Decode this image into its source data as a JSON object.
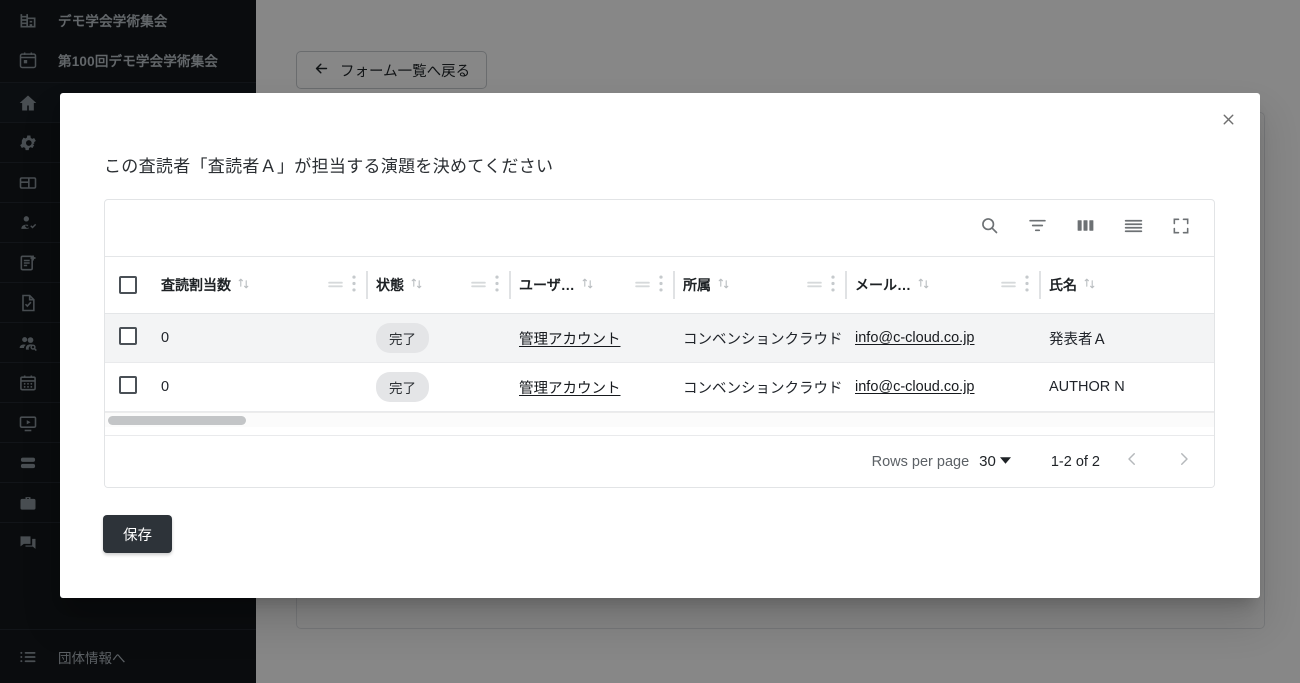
{
  "sidebar": {
    "org": [
      {
        "label": "デモ学会学術集会",
        "icon": "building-icon"
      },
      {
        "label": "第100回デモ学会学術集会",
        "icon": "calendar-icon"
      }
    ],
    "nav": [
      {
        "icon": "home-icon",
        "label": ""
      },
      {
        "icon": "gear-icon",
        "label": ""
      },
      {
        "icon": "layout-icon",
        "label": ""
      },
      {
        "icon": "person-check-icon",
        "label": ""
      },
      {
        "icon": "note-add-icon",
        "label": ""
      },
      {
        "icon": "document-check-icon",
        "label": ""
      },
      {
        "icon": "people-search-icon",
        "label": ""
      },
      {
        "icon": "calendar-month-icon",
        "label": ""
      },
      {
        "icon": "video-screen-icon",
        "label": ""
      },
      {
        "icon": "database-icon",
        "label": ""
      },
      {
        "icon": "briefcase-icon",
        "label": ""
      },
      {
        "icon": "chat-icon",
        "label": ""
      }
    ],
    "bottom": {
      "icon": "list-icon",
      "label": "団体情報へ"
    }
  },
  "page": {
    "back_button": "フォーム一覧へ戻る",
    "back_icon": "arrow-left-icon"
  },
  "modal": {
    "close_icon": "close-icon",
    "title": "この査読者「査読者Ａ」が担当する演題を決めてください",
    "save_label": "保存"
  },
  "grid": {
    "toolbar": [
      {
        "icon": "search-icon",
        "name": "search-button"
      },
      {
        "icon": "filter-icon",
        "name": "filter-button"
      },
      {
        "icon": "columns-icon",
        "name": "columns-button"
      },
      {
        "icon": "density-icon",
        "name": "density-button"
      },
      {
        "icon": "fullscreen-icon",
        "name": "fullscreen-button"
      }
    ],
    "columns": [
      {
        "label": "査読割当数",
        "sortable": true
      },
      {
        "label": "状態",
        "sortable": true
      },
      {
        "label": "ユーザ…",
        "sortable": true
      },
      {
        "label": "所属",
        "sortable": true
      },
      {
        "label": "メール…",
        "sortable": true
      },
      {
        "label": "氏名",
        "sortable": true
      }
    ],
    "rows": [
      {
        "selected": false,
        "assign_count": "0",
        "status": "完了",
        "user": "管理アカウント",
        "affiliation": "コンベンションクラウド",
        "email": "info@c-cloud.co.jp",
        "name": "発表者Ａ"
      },
      {
        "selected": false,
        "assign_count": "0",
        "status": "完了",
        "user": "管理アカウント",
        "affiliation": "コンベンションクラウド",
        "email": "info@c-cloud.co.jp",
        "name": "AUTHOR N"
      }
    ],
    "footer": {
      "rows_per_page_label": "Rows per page",
      "rows_per_page_value": "30",
      "range": "1-2 of 2",
      "prev_icon": "chevron-left-icon",
      "next_icon": "chevron-right-icon"
    }
  },
  "colors": {
    "sidebar_bg": "#13181c",
    "save_button_bg": "#2d3339",
    "chip_bg": "#e4e5e7",
    "overlay": "rgba(0,0,0,0.47)"
  }
}
